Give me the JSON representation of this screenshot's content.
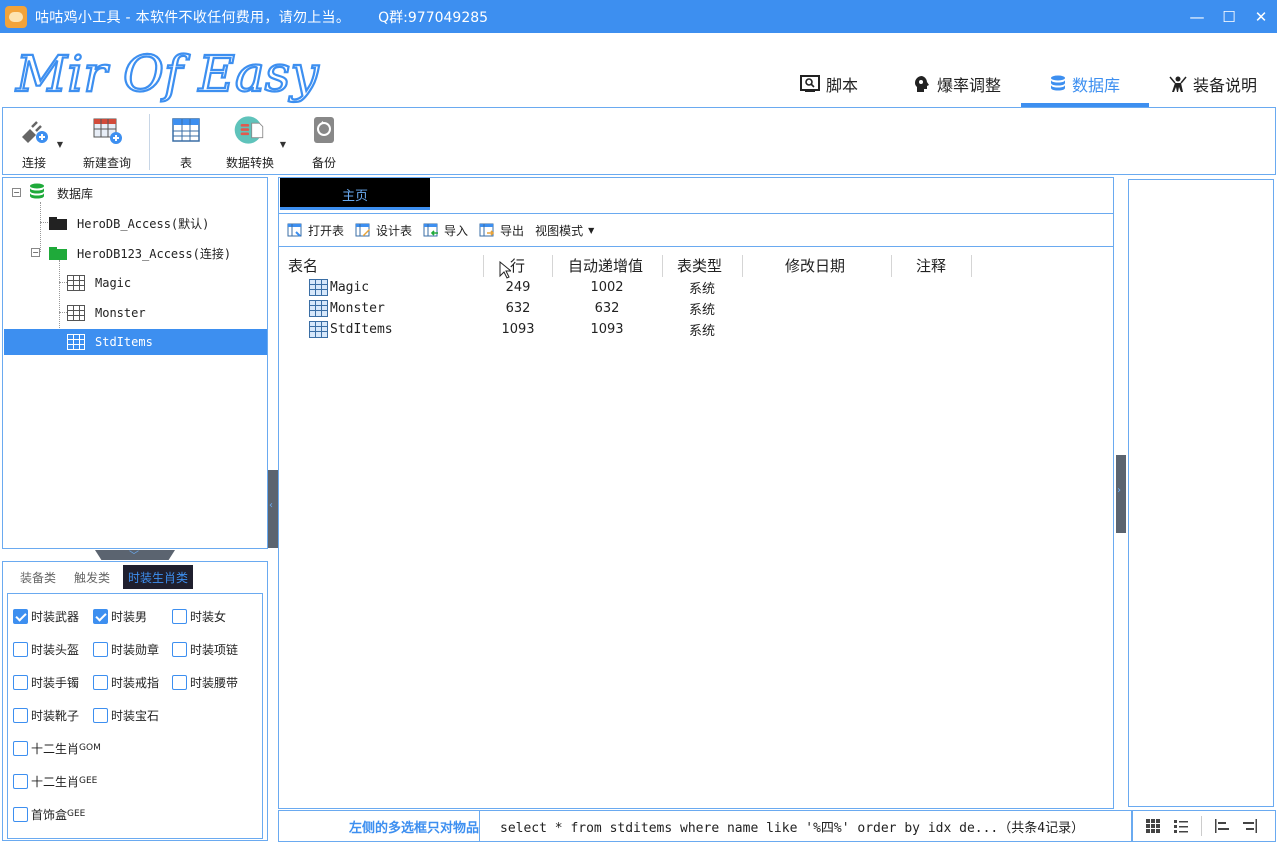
{
  "window": {
    "title": "咕咕鸡小工具 - 本软件不收任何费用，请勿上当。",
    "qq_group": "Q群:977049285",
    "minimize": "—",
    "maximize": "☐",
    "close": "✕"
  },
  "logo": {
    "text": "Mir Of Easy"
  },
  "nav_tabs": [
    {
      "label": "脚本",
      "icon": "script-icon"
    },
    {
      "label": "爆率调整",
      "icon": "head-gear-icon"
    },
    {
      "label": "数据库",
      "icon": "database-icon",
      "active": true
    },
    {
      "label": "装备说明",
      "icon": "equipment-icon"
    }
  ],
  "toolbar": {
    "connect": "连接",
    "new_query": "新建查询",
    "table": "表",
    "data_convert": "数据转换",
    "backup": "备份"
  },
  "tree": {
    "root": "数据库",
    "db1": "HeroDB_Access(默认)",
    "db2": "HeroDB123_Access(连接)",
    "tables": [
      "Magic",
      "Monster",
      "StdItems"
    ],
    "selected": "StdItems"
  },
  "check_tabs": [
    "装备类",
    "触发类",
    "时装生肖类"
  ],
  "check_active_tab": "时装生肖类",
  "checkboxes": [
    {
      "label": "时装武器",
      "checked": true
    },
    {
      "label": "时装男",
      "checked": true
    },
    {
      "label": "时装女",
      "checked": false
    },
    {
      "label": "时装头盔",
      "checked": false
    },
    {
      "label": "时装勋章",
      "checked": false
    },
    {
      "label": "时装项链",
      "checked": false
    },
    {
      "label": "时装手镯",
      "checked": false
    },
    {
      "label": "时装戒指",
      "checked": false
    },
    {
      "label": "时装腰带",
      "checked": false
    },
    {
      "label": "时装靴子",
      "checked": false
    },
    {
      "label": "时装宝石",
      "checked": false
    },
    {
      "label": "十二生肖",
      "suffix": "GOM",
      "checked": false
    },
    {
      "label": "十二生肖",
      "suffix": "GEE",
      "checked": false
    },
    {
      "label": "首饰盒",
      "suffix": "GEE",
      "checked": false
    }
  ],
  "main": {
    "doc_tab": "主页",
    "sub_toolbar": [
      "打开表",
      "设计表",
      "导入",
      "导出",
      "视图模式"
    ],
    "columns": [
      "表名",
      "行",
      "自动递增值",
      "表类型",
      "修改日期",
      "注释"
    ],
    "rows": [
      {
        "name": "Magic",
        "rows": "249",
        "auto_inc": "1002",
        "type": "系统",
        "modified": "",
        "comment": ""
      },
      {
        "name": "Monster",
        "rows": "632",
        "auto_inc": "632",
        "type": "系统",
        "modified": "",
        "comment": ""
      },
      {
        "name": "StdItems",
        "rows": "1093",
        "auto_inc": "1093",
        "type": "系统",
        "modified": "",
        "comment": ""
      }
    ]
  },
  "status": {
    "hint": "左侧的多选框只对物品",
    "sql": "select * from stditems where name like '%四%' order by idx de...（共条4记录）"
  },
  "colors": {
    "accent": "#3d8ff0",
    "border": "#6aaaf0",
    "green": "#1faa3a"
  }
}
